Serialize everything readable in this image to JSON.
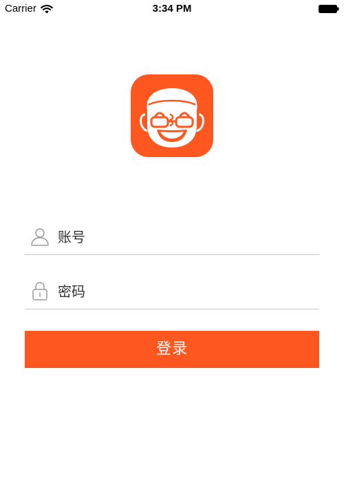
{
  "status_bar": {
    "carrier": "Carrier",
    "time": "3:34 PM",
    "wifi_icon": "wifi-icon",
    "battery_icon": "battery-icon"
  },
  "logo": {
    "icon": "smiling-old-man-with-glasses-icon",
    "background_color": "#ff5720"
  },
  "form": {
    "account": {
      "icon": "user-icon",
      "placeholder": "账号",
      "value": ""
    },
    "password": {
      "icon": "lock-icon",
      "placeholder": "密码",
      "value": ""
    },
    "login_button": {
      "label": "登录",
      "color": "#ff5720",
      "text_color": "#ffffff"
    }
  }
}
